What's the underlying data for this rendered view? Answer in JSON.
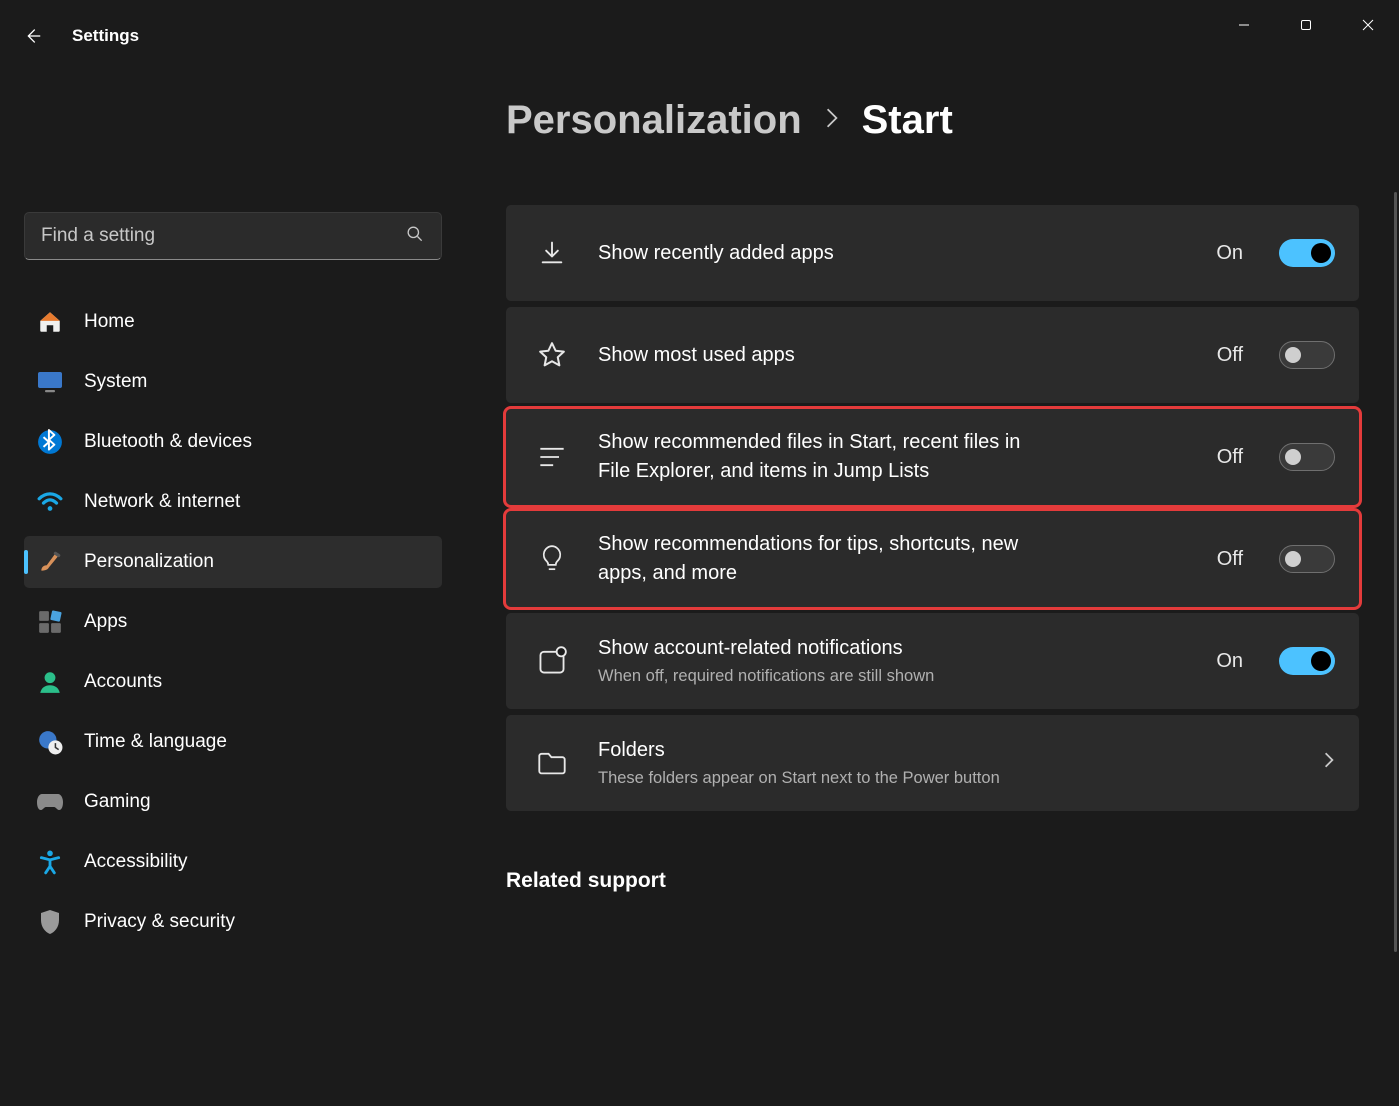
{
  "app_title": "Settings",
  "search": {
    "placeholder": "Find a setting"
  },
  "nav": {
    "items": [
      {
        "label": "Home"
      },
      {
        "label": "System"
      },
      {
        "label": "Bluetooth & devices"
      },
      {
        "label": "Network & internet"
      },
      {
        "label": "Personalization"
      },
      {
        "label": "Apps"
      },
      {
        "label": "Accounts"
      },
      {
        "label": "Time & language"
      },
      {
        "label": "Gaming"
      },
      {
        "label": "Accessibility"
      },
      {
        "label": "Privacy & security"
      }
    ]
  },
  "breadcrumb": {
    "parent": "Personalization",
    "current": "Start"
  },
  "settings": [
    {
      "title": "Show recently added apps",
      "sub": "",
      "state": "On"
    },
    {
      "title": "Show most used apps",
      "sub": "",
      "state": "Off"
    },
    {
      "title": "Show recommended files in Start, recent files in File Explorer, and items in Jump Lists",
      "sub": "",
      "state": "Off"
    },
    {
      "title": "Show recommendations for tips, shortcuts, new apps, and more",
      "sub": "",
      "state": "Off"
    },
    {
      "title": "Show account-related notifications",
      "sub": "When off, required notifications are still shown",
      "state": "On"
    },
    {
      "title": "Folders",
      "sub": "These folders appear on Start next to the Power button",
      "state": ""
    }
  ],
  "section": {
    "related_support": "Related support"
  }
}
